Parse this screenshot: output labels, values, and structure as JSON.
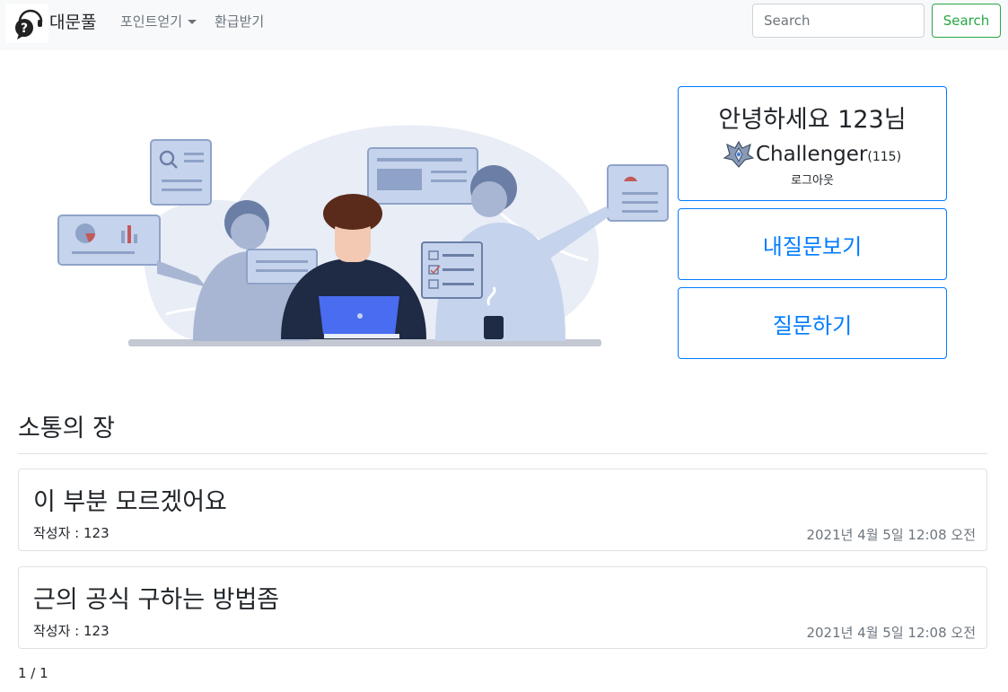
{
  "navbar": {
    "brand": "대문풀",
    "logo_icon": "question-speech-bubble-icon",
    "points_menu": "포인트얻기",
    "refund_link": "환급받기",
    "search_placeholder": "Search",
    "search_button": "Search",
    "accent_color": "#28a745"
  },
  "profile": {
    "greeting": "안녕하세요 123님",
    "rank_icon": "challenger-crest-icon",
    "rank_name": "Challenger",
    "rank_score": "(115)",
    "logout": "로그아웃"
  },
  "actions": {
    "my_questions": "내질문보기",
    "ask_question": "질문하기",
    "accent_color": "#007bff"
  },
  "board": {
    "title": "소통의 장",
    "posts": [
      {
        "title": "이 부분 모르겠어요",
        "author": "작성자 : 123",
        "date": "2021년 4월 5일 12:08 오전"
      },
      {
        "title": "근의 공식 구하는 방법좀",
        "author": "작성자 : 123",
        "date": "2021년 4월 5일 12:08 오전"
      }
    ],
    "pagination": "1 / 1"
  }
}
